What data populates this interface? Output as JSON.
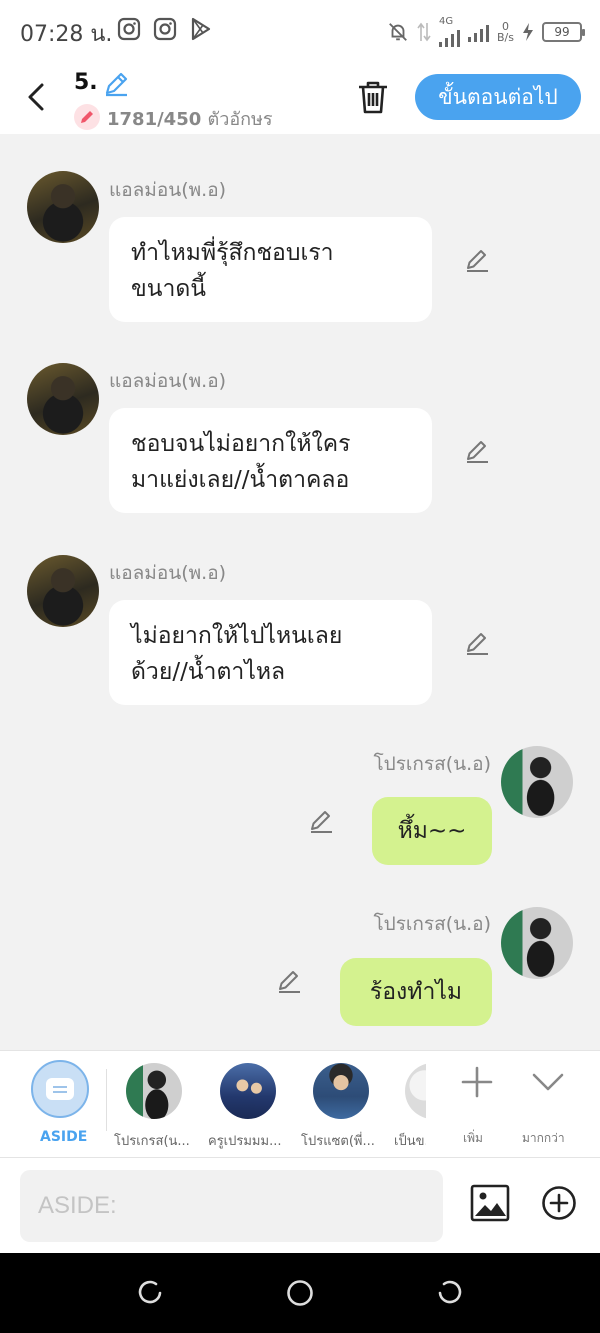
{
  "status_bar": {
    "time": "07:28 น.",
    "network": "4G",
    "speed_value": "0",
    "speed_unit": "B/s",
    "battery": "99"
  },
  "header": {
    "episode_title": "5.",
    "char_count": "1781/450",
    "char_unit": "ตัวอักษร",
    "next_button": "ขั้นตอนต่อไป"
  },
  "messages": [
    {
      "side": "left",
      "sender": "แอลม่อน(พ.อ)",
      "text": "ทำไหมพี่รุ้สึกชอบเรา\nขนาดนี้"
    },
    {
      "side": "left",
      "sender": "แอลม่อน(พ.อ)",
      "text": "ชอบจนไม่อยากให้ใคร\nมาแย่งเลย//น้ำตาคลอ"
    },
    {
      "side": "left",
      "sender": "แอลม่อน(พ.อ)",
      "text": "ไม่อยากให้ไปไหนเลย\nด้วย//น้ำตาไหล"
    },
    {
      "side": "right",
      "sender": "โปรเกรส(น.อ)",
      "text": "หึ้ม~~"
    },
    {
      "side": "right",
      "sender": "โปรเกรส(น.อ)",
      "text": "ร้องทำไม"
    }
  ],
  "character_bar": {
    "aside_label": "ASIDE",
    "characters": [
      {
        "name": "โปรเกรส(น..."
      },
      {
        "name": "ครูเปรมมม..."
      },
      {
        "name": "โปรแซต(พี่..."
      },
      {
        "name": "เป็นข..."
      }
    ],
    "add_label": "เพิ่ม",
    "more_label": "มากกว่า"
  },
  "input": {
    "placeholder": "ASIDE:",
    "value": ""
  },
  "colors": {
    "accent": "#4aa3ef",
    "my_bubble": "#d4f28f",
    "other_bubble": "#ffffff",
    "chat_background": "#f2f2f2"
  }
}
